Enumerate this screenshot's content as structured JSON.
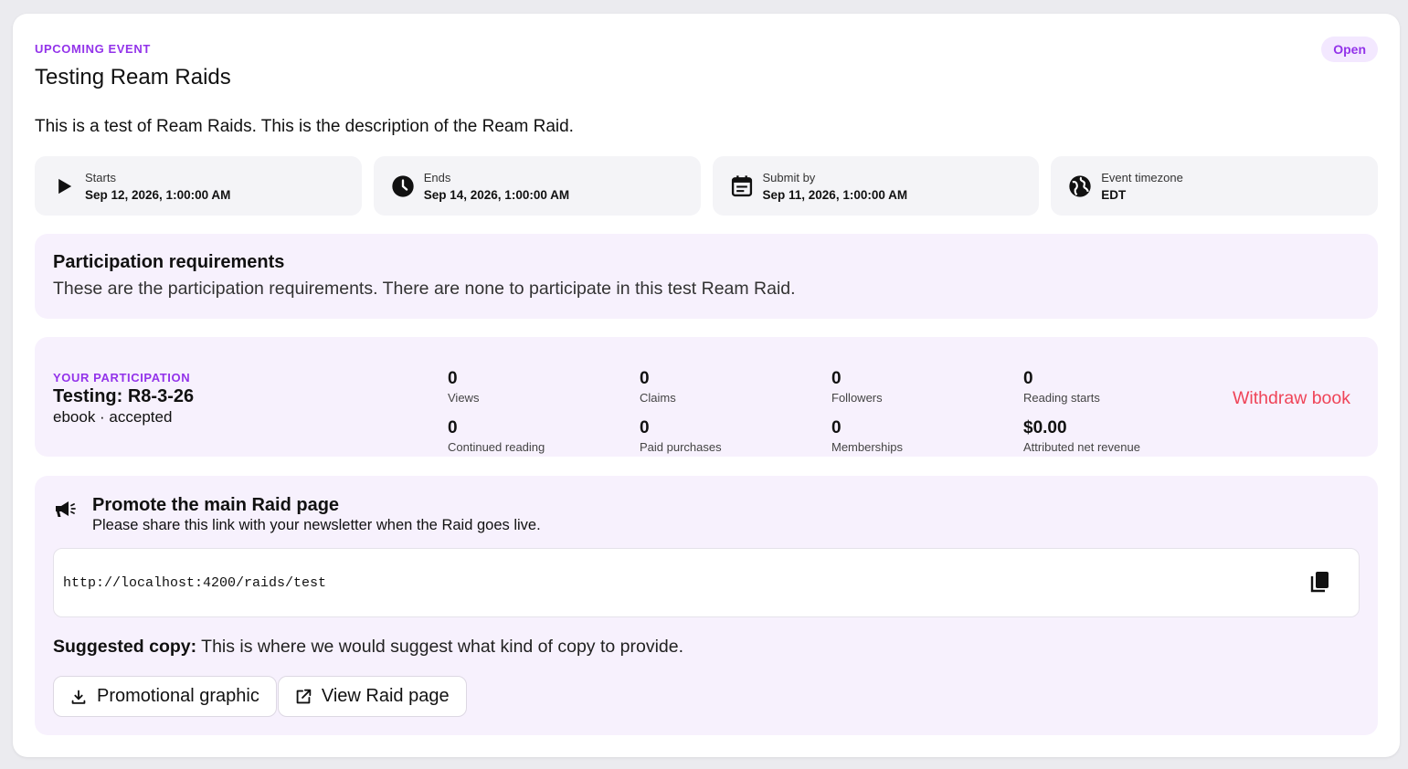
{
  "event": {
    "eyebrow": "UPCOMING EVENT",
    "title": "Testing Ream Raids",
    "status": "Open",
    "description": "This is a test of Ream Raids. This is the description of the Ream Raid."
  },
  "info_tiles": [
    {
      "icon": "play-icon",
      "label": "Starts",
      "value": "Sep 12, 2026, 1:00:00 AM"
    },
    {
      "icon": "clock-icon",
      "label": "Ends",
      "value": "Sep 14, 2026, 1:00:00 AM"
    },
    {
      "icon": "calendar-icon",
      "label": "Submit by",
      "value": "Sep 11, 2026, 1:00:00 AM"
    },
    {
      "icon": "globe-icon",
      "label": "Event timezone",
      "value": "EDT"
    }
  ],
  "requirements": {
    "title": "Participation requirements",
    "text": "These are the participation requirements. There are none to participate in this test Ream Raid."
  },
  "participation": {
    "eyebrow": "YOUR PARTICIPATION",
    "title": "Testing: R8-3-26",
    "subtitle": "ebook · accepted",
    "metrics": [
      {
        "value": "0",
        "label": "Views"
      },
      {
        "value": "0",
        "label": "Claims"
      },
      {
        "value": "0",
        "label": "Followers"
      },
      {
        "value": "0",
        "label": "Reading starts"
      },
      {
        "value": "0",
        "label": "Continued reading"
      },
      {
        "value": "0",
        "label": "Paid purchases"
      },
      {
        "value": "0",
        "label": "Memberships"
      },
      {
        "value": "$0.00",
        "label": "Attributed net revenue"
      }
    ],
    "withdraw_label": "Withdraw book"
  },
  "promote": {
    "title": "Promote the main Raid page",
    "subtitle": "Please share this link with your newsletter when the Raid goes live.",
    "link": "http://localhost:4200/raids/test",
    "suggested_label": "Suggested copy:",
    "suggested_text": " This is where we would suggest what kind of copy to provide.",
    "graphic_button": "Promotional graphic",
    "view_button": "View Raid page"
  },
  "colors": {
    "accent": "#9333ea",
    "danger": "#ef4458",
    "tile_bg": "#f4f4f7",
    "panel_bg": "#f7f1fd"
  }
}
